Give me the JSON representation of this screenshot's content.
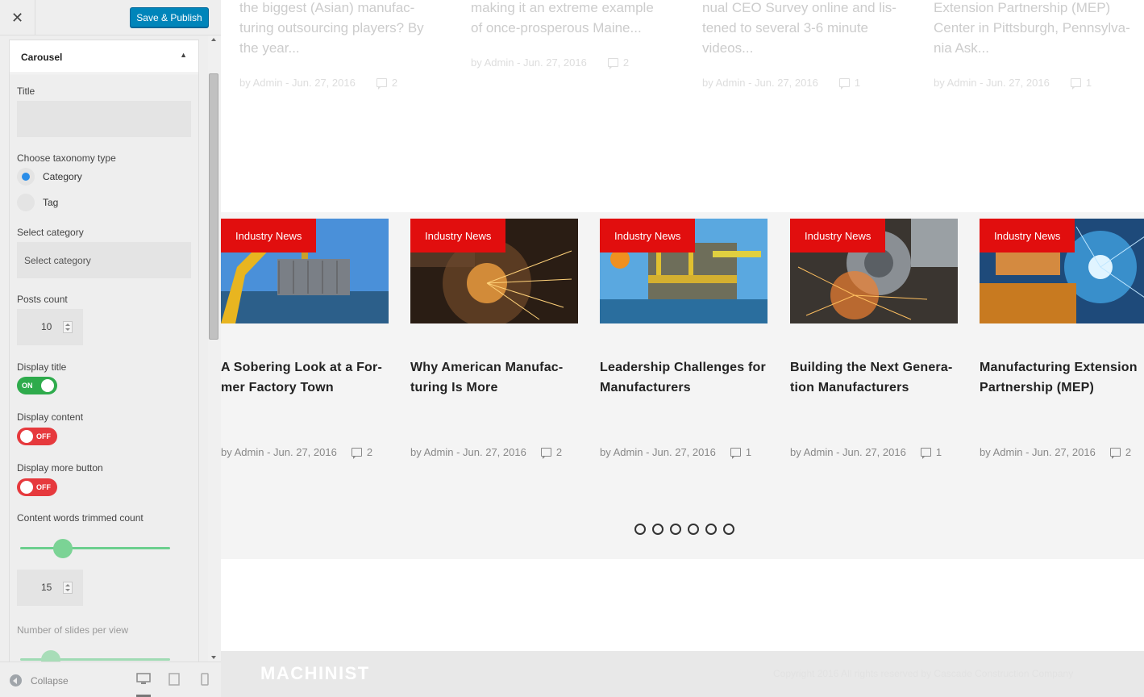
{
  "sidebar": {
    "close_icon": "close-icon",
    "publish_label": "Save & Publish",
    "section_title": "Carousel",
    "title_label": "Title",
    "title_value": "",
    "taxonomy_label": "Choose taxonomy type",
    "taxonomy_options": [
      "Category",
      "Tag"
    ],
    "taxonomy_selected": "Category",
    "category_label": "Select category",
    "category_placeholder": "Select category",
    "posts_count_label": "Posts count",
    "posts_count_value": "10",
    "display_title_label": "Display title",
    "display_title_state": "ON",
    "display_content_label": "Display content",
    "display_content_state": "OFF",
    "display_more_label": "Display more button",
    "display_more_state": "OFF",
    "trim_label": "Content words trimmed count",
    "trim_value": "15",
    "slides_label": "Number of slides per view",
    "collapse_label": "Collapse",
    "devices": [
      "desktop-icon",
      "tablet-icon",
      "mobile-icon"
    ],
    "accent_colors": {
      "publish": "#0085ba",
      "toggle_on": "#2eab4c",
      "toggle_off": "#e6393d",
      "radio": "#2a8de8"
    }
  },
  "preview": {
    "faded_posts": [
      {
        "excerpt": [
          "the biggest (Asian) manufac-",
          "turing outsourcing players? By",
          "the year..."
        ],
        "meta": "by Admin - Jun. 27, 2016",
        "comments": "2"
      },
      {
        "excerpt": [
          "making it an extreme example",
          "of once-prosperous Maine..."
        ],
        "meta": "by Admin - Jun. 27, 2016",
        "comments": "2"
      },
      {
        "excerpt": [
          "nual CEO Survey online and lis-",
          "tened to several 3-6 minute",
          "videos..."
        ],
        "meta": "by Admin - Jun. 27, 2016",
        "comments": "1"
      },
      {
        "excerpt": [
          "Extension Partnership (MEP)",
          "Center in Pittsburgh, Pennsylva-",
          "nia Ask..."
        ],
        "meta": "by Admin - Jun. 27, 2016",
        "comments": "1"
      }
    ],
    "carousel_posts": [
      {
        "badge": "Industry News",
        "title": [
          "A Sobering Look at a For-",
          "mer Factory Town"
        ],
        "meta": "by Admin - Jun. 27, 2016",
        "comments": "2"
      },
      {
        "badge": "Industry News",
        "title": [
          "Why American Manufac-",
          "turing Is More"
        ],
        "meta": "by Admin - Jun. 27, 2016",
        "comments": "2"
      },
      {
        "badge": "Industry News",
        "title": [
          "Leadership Challenges for",
          "Manufacturers"
        ],
        "meta": "by Admin - Jun. 27, 2016",
        "comments": "1"
      },
      {
        "badge": "Industry News",
        "title": [
          "Building the Next Genera-",
          "tion Manufacturers"
        ],
        "meta": "by Admin - Jun. 27, 2016",
        "comments": "1"
      },
      {
        "badge": "Industry News",
        "title": [
          "Manufacturing Extension",
          "Partnership (MEP)"
        ],
        "meta": "by Admin - Jun. 27, 2016",
        "comments": "2"
      }
    ],
    "dots_count": 6,
    "badge_color": "#e10e0e",
    "footer_logo": "MACHINIST",
    "footer_copy": "Copyright 2016 All rights reserved by Cascade Construction Company"
  }
}
